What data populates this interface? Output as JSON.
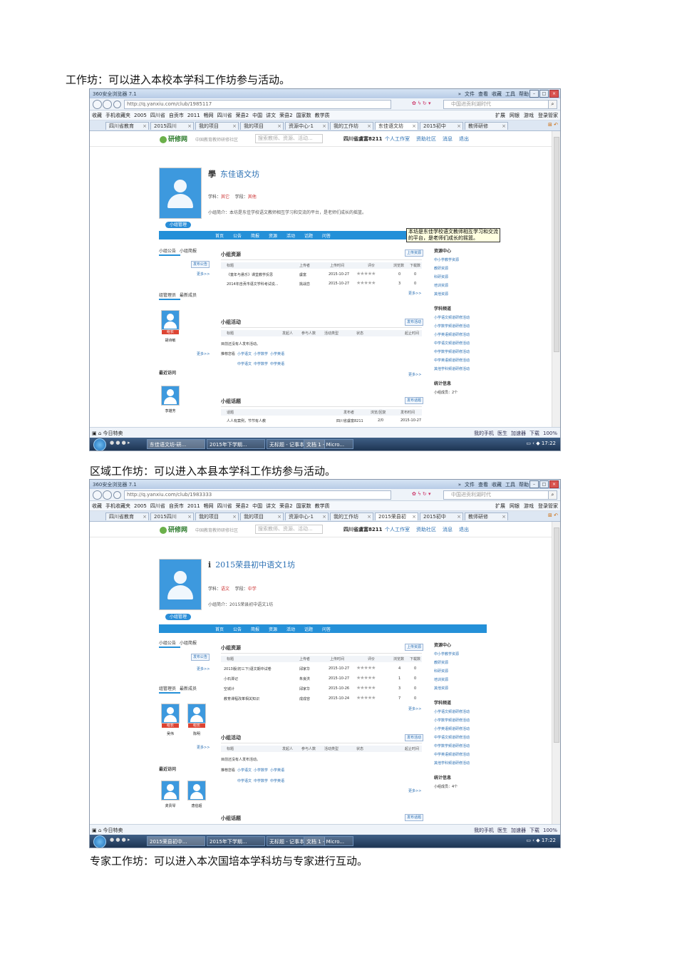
{
  "captions": {
    "c1": "工作坊：可以进入本校本学科工作坊参与活动。",
    "c2": "区域工作坊：可以进入本县本学科工作坊参与活动。",
    "c3": "专家工作坊：可以进入本次国培本学科坊与专家进行互动。"
  },
  "browser": {
    "title": "360安全浏览器 7.1",
    "menus": [
      "»",
      "文件",
      "查看",
      "收藏",
      "工具",
      "帮助"
    ],
    "search_placeholder": "中国进贡利湖时代",
    "favorites": [
      "收藏",
      "手机收藏夹",
      "2005",
      "四川省",
      "自贡市",
      "2011",
      "畅网",
      "四川省",
      "荣县2",
      "中国",
      "讲文",
      "荣县2",
      "国家数",
      "教学质"
    ],
    "favorites_right": [
      "扩展",
      "网银",
      "游戏",
      "登录管家"
    ],
    "status_left": "今日特卖",
    "status_right": [
      "我的手机",
      "医生",
      "加速器",
      "下载",
      "100%"
    ],
    "clock": "17:22",
    "task_buttons": [
      "2015年下学期...",
      "无标题 - 记事本",
      "文档 1 - Micro..."
    ]
  },
  "site": {
    "logo": "研修网",
    "slogan": "中国教育教师研修社区",
    "search_placeholder": "搜索教师、资源、活动...",
    "user": "四川省虞富8211",
    "links": [
      "个人工作室",
      "资助社区",
      "消息",
      "退出"
    ],
    "nav": [
      "首页",
      "公告",
      "简报",
      "资源",
      "活动",
      "话题",
      "问答"
    ],
    "mgmt": "小组管理",
    "left_tabs": [
      "小组公告",
      "小组简报"
    ],
    "left_members": [
      "组管理员",
      "最新成员"
    ],
    "recent": "最近访问",
    "publish_notice": "发布公告",
    "more": "更多>>",
    "sections": [
      "小组资源",
      "小组活动",
      "小组话题"
    ],
    "res_cols": [
      "标题",
      "上传者",
      "上传时间",
      "评价",
      "浏览数",
      "下载数"
    ],
    "act_cols": [
      "标题",
      "发起人",
      "参与人数",
      "活动类型",
      "状态",
      "起止时间"
    ],
    "topic_cols": [
      "话题",
      "发布者",
      "浏览/回复",
      "发布时间"
    ],
    "upload_btn": "上传资源",
    "act_btn": "发布活动",
    "topic_btn": "发布话题",
    "empty_act": "目前还没有人发布活动。",
    "recommend": "推荐您看",
    "rec_links_1": [
      "小学语文",
      "小学数学",
      "小学英语"
    ],
    "rec_links_2": [
      "中学语文",
      "中学数学",
      "中学英语"
    ],
    "right_res_title": "资源中心",
    "right_res": [
      "中小学教学资源",
      "教研资源",
      "科研资源",
      "培训资源",
      "其他资源"
    ],
    "right_ch_title": "学科频道",
    "right_ch": [
      "小学语文频道研修活动",
      "小学数学频道研修活动",
      "小学英语频道研修活动",
      "中学语文频道研修活动",
      "中学数学频道研修活动",
      "中学英语频道研修活动",
      "其他学科频道研修活动"
    ],
    "right_stat_title": "统计信息"
  },
  "shot1": {
    "url": "http://q.yanxiu.com/club/1985117",
    "tabs": [
      "四川省教育",
      "2015四川",
      "我的项目",
      "我的项目",
      "资源中心-1",
      "我的工作坊",
      "东佳语文坊",
      "2015初中",
      "教师研修"
    ],
    "group_name": "东佳语文坊",
    "subject_label": "学科：",
    "subject": "其它",
    "stage_label": "学段：",
    "stage": "其他",
    "intro_label": "小组简介：",
    "intro": "本坊是东佳学校语文教师相互学习和交流的平台，是老师们成长的摇篮。",
    "tooltip_1": "本坊是东佳学校语文教师相互学习和交流",
    "tooltip_2": "的平台，是老师们成长的摇篮。",
    "resources": [
      {
        "title": "《童年与悬乐》课堂教学反思",
        "uploader": "虞富",
        "date": "2015-10-27",
        "views": "0",
        "downloads": "0"
      },
      {
        "title": "2014年自贡市语文学科考试说...",
        "uploader": "挑战恋",
        "date": "2015-10-27",
        "views": "3",
        "downloads": "0"
      }
    ],
    "members": [
      {
        "role": "组长",
        "name": "胡诗敏"
      }
    ],
    "recent": [
      {
        "name": "李雄芳"
      }
    ],
    "topic_row": {
      "title": "人人有案例，节节有人教",
      "author": "四川省虞富8211",
      "stats": "2/0",
      "date": "2015-10-27"
    },
    "stat_count": "小组成员：2个",
    "task_active": "东佳语文坊-研..."
  },
  "shot2": {
    "url": "http://q.yanxiu.com/club/1983333",
    "tabs": [
      "四川省教育",
      "2015四川",
      "我的项目",
      "我的项目",
      "资源中心-1",
      "我的工作坊",
      "2015荣县初",
      "2015初中",
      "教师研修"
    ],
    "group_name": "2015荣县初中语文1坊",
    "subject_label": "学科：",
    "subject": "语文",
    "stage_label": "学段：",
    "stage": "中学",
    "intro_label": "小组简介：",
    "intro": "2015荣县初中语文1坊",
    "resources": [
      {
        "title": "2013版(初三下)语文期中试卷",
        "uploader": "邱家华",
        "date": "2015-10-27",
        "views": "4",
        "downloads": "0"
      },
      {
        "title": "小石潭记",
        "uploader": "朱良洪",
        "date": "2015-10-27",
        "views": "1",
        "downloads": "0"
      },
      {
        "title": "空城计",
        "uploader": "邱家华",
        "date": "2015-10-26",
        "views": "3",
        "downloads": "0"
      },
      {
        "title": "教育课程改革相关知识",
        "uploader": "成成容",
        "date": "2015-10-24",
        "views": "7",
        "downloads": "0"
      }
    ],
    "members": [
      {
        "role": "组长",
        "name": "吴伟"
      },
      {
        "role": "组长",
        "name": "陈明"
      }
    ],
    "recent": [
      {
        "name": "龚贵琴"
      },
      {
        "name": "唐伯超"
      }
    ],
    "stat_count": "小组成员：4个",
    "task_active": "2015荣县初中..."
  }
}
